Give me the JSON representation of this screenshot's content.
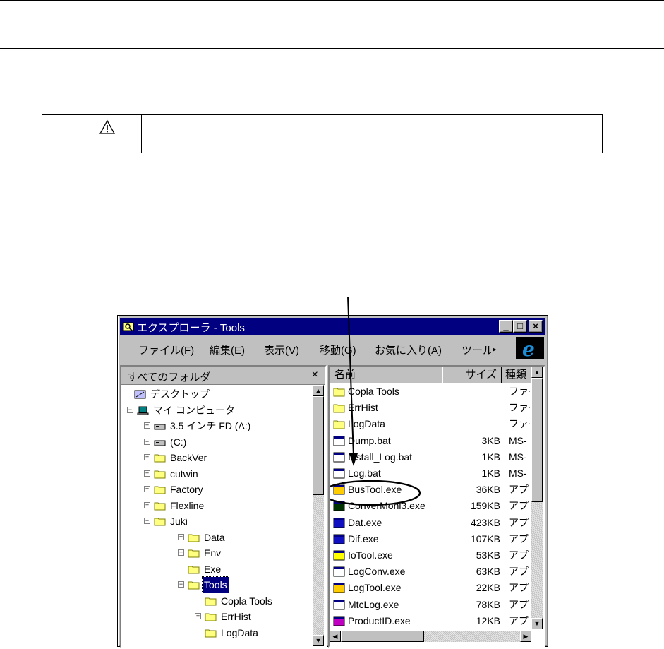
{
  "document": {
    "warning_icon": "warning-triangle-icon"
  },
  "explorer": {
    "title": "エクスプローラ - Tools",
    "window_buttons": {
      "minimize": "_",
      "maximize": "□",
      "close": "×"
    },
    "menu": [
      "ファイル(F)",
      "編集(E)",
      "表示(V)",
      "移動(G)",
      "お気に入り(A)",
      "ツール"
    ],
    "folder_pane": {
      "title": "すべてのフォルダ",
      "close": "×",
      "tree": [
        {
          "label": "デスクトップ",
          "icon": "desktop-icon",
          "level": 0,
          "toggle": ""
        },
        {
          "label": "マイ コンピュータ",
          "icon": "computer-icon",
          "level": 1,
          "toggle": "−"
        },
        {
          "label": "3.5 インチ FD (A:)",
          "icon": "floppy-drive-icon",
          "level": 2,
          "toggle": "+"
        },
        {
          "label": "(C:)",
          "icon": "hard-drive-icon",
          "level": 2,
          "toggle": "−"
        },
        {
          "label": "BackVer",
          "icon": "folder-icon",
          "level": 3,
          "toggle": "+"
        },
        {
          "label": "cutwin",
          "icon": "folder-icon",
          "level": 3,
          "toggle": "+"
        },
        {
          "label": "Factory",
          "icon": "folder-icon",
          "level": 3,
          "toggle": "+"
        },
        {
          "label": "Flexline",
          "icon": "folder-icon",
          "level": 3,
          "toggle": "+"
        },
        {
          "label": "Juki",
          "icon": "folder-icon",
          "level": 3,
          "toggle": "−"
        },
        {
          "label": "Data",
          "icon": "folder-icon",
          "level": 4,
          "toggle": "+"
        },
        {
          "label": "Env",
          "icon": "folder-icon",
          "level": 4,
          "toggle": "+"
        },
        {
          "label": "Exe",
          "icon": "folder-icon",
          "level": 4,
          "toggle": ""
        },
        {
          "label": "Tools",
          "icon": "open-folder-icon",
          "level": 4,
          "toggle": "−",
          "selected": true
        },
        {
          "label": "Copla Tools",
          "icon": "folder-icon",
          "level": 5,
          "toggle": ""
        },
        {
          "label": "ErrHist",
          "icon": "folder-icon",
          "level": 5,
          "toggle": "+"
        },
        {
          "label": "LogData",
          "icon": "folder-icon",
          "level": 5,
          "toggle": ""
        }
      ]
    },
    "file_list": {
      "columns": [
        "名前",
        "サイズ",
        "種類"
      ],
      "files": [
        {
          "name": "Copla Tools",
          "size": "",
          "type": "ファイ",
          "icon": "folder-icon"
        },
        {
          "name": "ErrHist",
          "size": "",
          "type": "ファイ",
          "icon": "folder-icon"
        },
        {
          "name": "LogData",
          "size": "",
          "type": "ファイ",
          "icon": "folder-icon"
        },
        {
          "name": "Dump.bat",
          "size": "3KB",
          "type": "MS-",
          "icon": "batch-file-icon"
        },
        {
          "name": "Install_Log.bat",
          "size": "1KB",
          "type": "MS-",
          "icon": "batch-file-icon"
        },
        {
          "name": "Log.bat",
          "size": "1KB",
          "type": "MS-",
          "icon": "batch-file-icon",
          "highlighted": true
        },
        {
          "name": "BusTool.exe",
          "size": "36KB",
          "type": "アプリ",
          "icon": "bustool-exe-icon"
        },
        {
          "name": "ConverMoni3.exe",
          "size": "159KB",
          "type": "アプリ",
          "icon": "convermoni-exe-icon"
        },
        {
          "name": "Dat.exe",
          "size": "423KB",
          "type": "アプリ",
          "icon": "dat-exe-icon"
        },
        {
          "name": "Dif.exe",
          "size": "107KB",
          "type": "アプリ",
          "icon": "dif-exe-icon"
        },
        {
          "name": "IoTool.exe",
          "size": "53KB",
          "type": "アプリ",
          "icon": "iotool-exe-icon"
        },
        {
          "name": "LogConv.exe",
          "size": "63KB",
          "type": "アプリ",
          "icon": "logconv-exe-icon"
        },
        {
          "name": "LogTool.exe",
          "size": "22KB",
          "type": "アプリ",
          "icon": "logtool-exe-icon"
        },
        {
          "name": "MtcLog.exe",
          "size": "78KB",
          "type": "アプリ",
          "icon": "mtclog-exe-icon"
        },
        {
          "name": "ProductID.exe",
          "size": "12KB",
          "type": "アプリ",
          "icon": "productid-exe-icon"
        }
      ]
    }
  }
}
